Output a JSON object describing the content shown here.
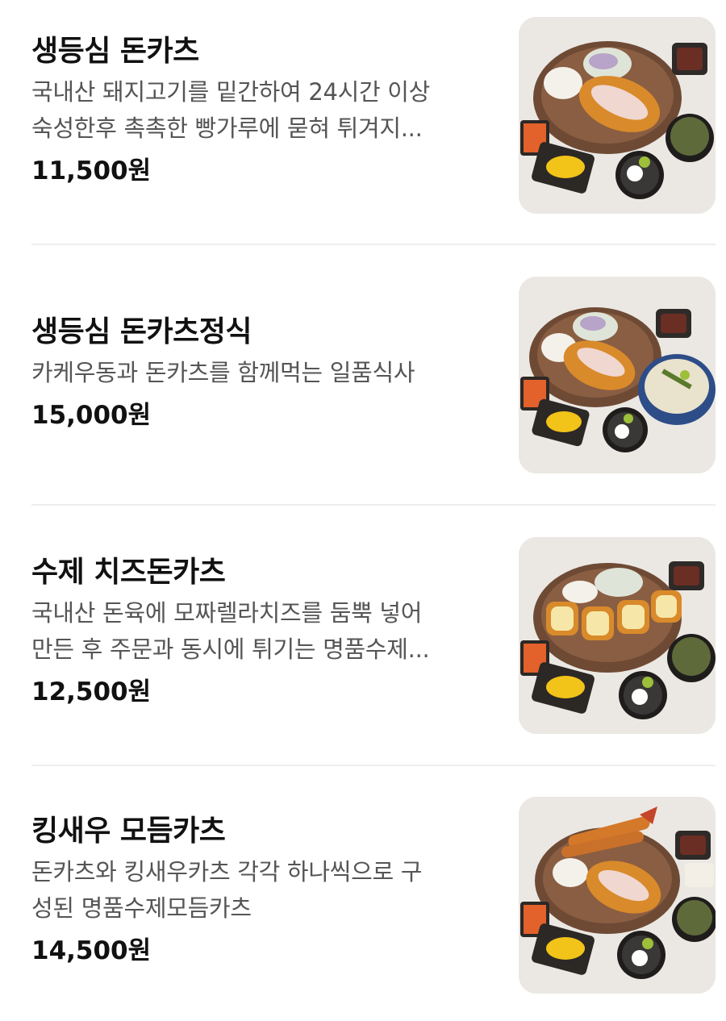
{
  "menu": {
    "items": [
      {
        "name": "생등심 돈카츠",
        "desc_lines": [
          "국내산 돼지고기를 밑간하여 24시간 이상",
          "숙성한후 촉촉한 빵가루에 묻혀 튀겨지..."
        ],
        "price": "11,500원",
        "image_icon": "pork-cutlet-set-photo"
      },
      {
        "name": "생등심 돈카츠정식",
        "desc_lines": [
          "카케우동과 돈카츠를 함께먹는 일품식사"
        ],
        "price": "15,000원",
        "image_icon": "pork-cutlet-udon-set-photo"
      },
      {
        "name": "수제 치즈돈카츠",
        "desc_lines": [
          "국내산 돈육에 모짜렐라치즈를 둠뿍 넣어",
          "만든 후 주문과 동시에 튀기는 명품수제..."
        ],
        "price": "12,500원",
        "image_icon": "cheese-cutlet-set-photo"
      },
      {
        "name": "킹새우 모듬카츠",
        "desc_lines": [
          "돈카츠와 킹새우카츠 각각 하나씩으로 구",
          "성된 명품수제모듬카츠"
        ],
        "price": "14,500원",
        "image_icon": "shrimp-cutlet-set-photo"
      }
    ]
  }
}
